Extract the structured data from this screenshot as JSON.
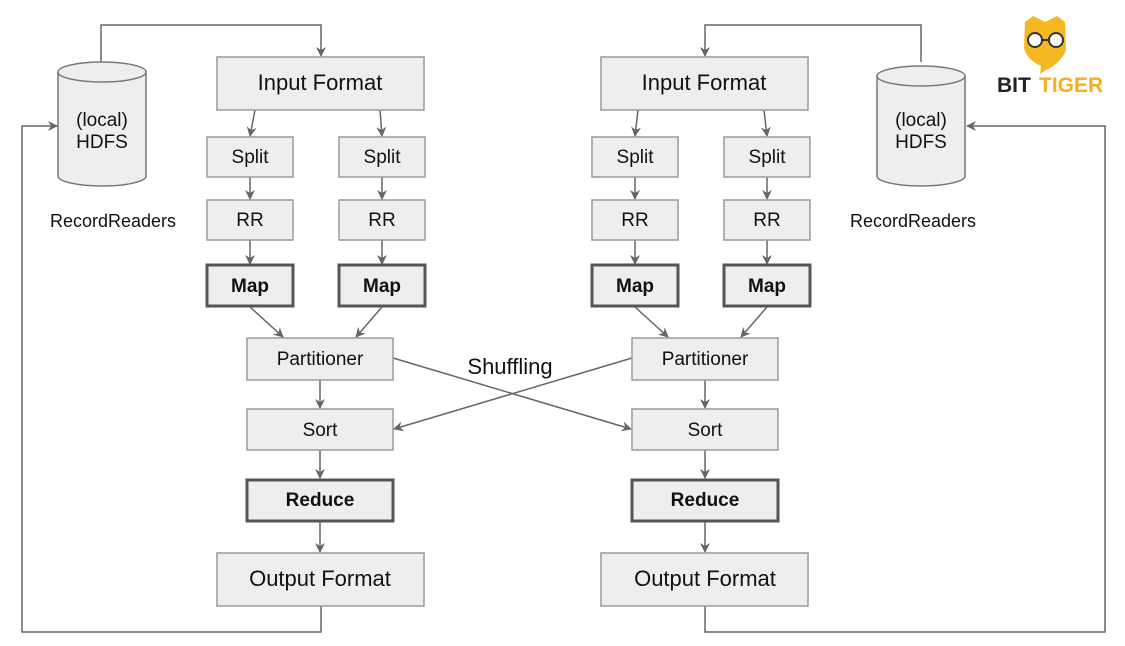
{
  "logo": {
    "text_1": "BIT",
    "text_2": "TIGER",
    "color": "#f2b01e"
  },
  "left": {
    "hdfs_line1": "(local)",
    "hdfs_line2": "HDFS",
    "record_readers": "RecordReaders",
    "input_format": "Input Format",
    "split_a": "Split",
    "split_b": "Split",
    "rr_a": "RR",
    "rr_b": "RR",
    "map_a": "Map",
    "map_b": "Map",
    "partitioner": "Partitioner",
    "sort": "Sort",
    "reduce": "Reduce",
    "output_format": "Output Format"
  },
  "right": {
    "hdfs_line1": "(local)",
    "hdfs_line2": "HDFS",
    "record_readers": "RecordReaders",
    "input_format": "Input Format",
    "split_a": "Split",
    "split_b": "Split",
    "rr_a": "RR",
    "rr_b": "RR",
    "map_a": "Map",
    "map_b": "Map",
    "partitioner": "Partitioner",
    "sort": "Sort",
    "reduce": "Reduce",
    "output_format": "Output Format"
  },
  "shuffling_label": "Shuffling",
  "colors": {
    "box_fill": "#eeeeee",
    "line": "#666666",
    "logo_accent": "#f2b01e"
  }
}
